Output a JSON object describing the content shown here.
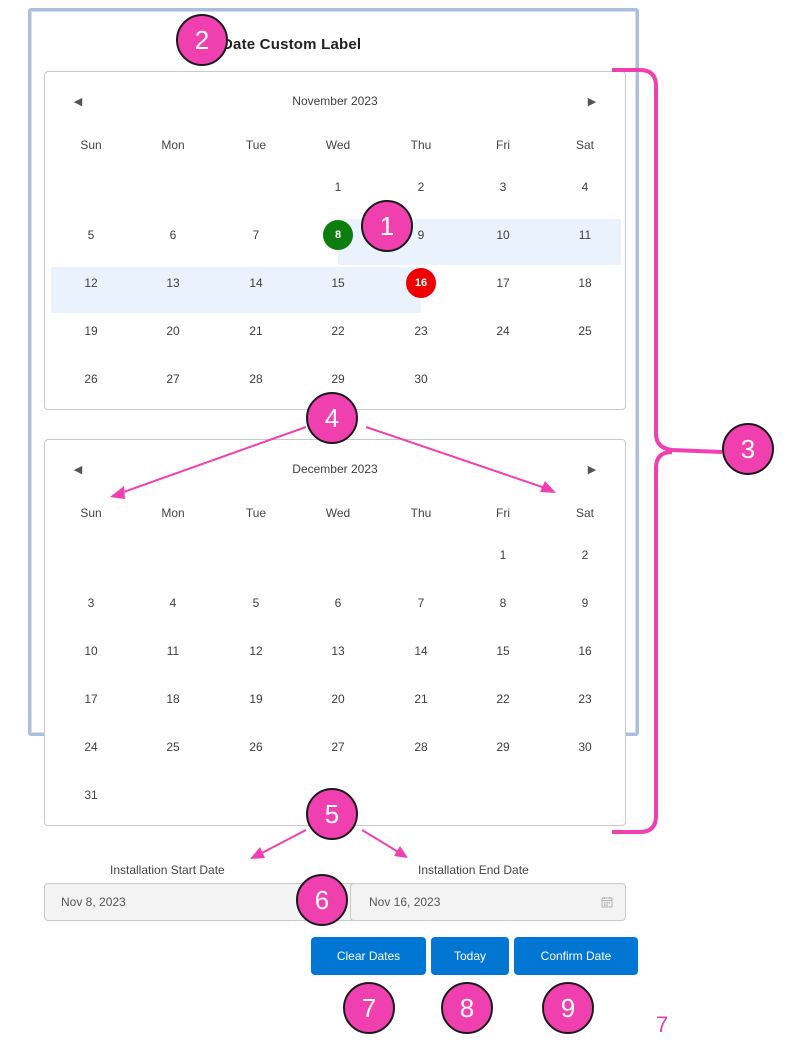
{
  "title": "Date Custom Label",
  "calendars": [
    {
      "month": "November 2023",
      "dow": [
        "Sun",
        "Mon",
        "Tue",
        "Wed",
        "Thu",
        "Fri",
        "Sat"
      ],
      "weeks": [
        [
          "",
          "",
          "",
          "1",
          "2",
          "3",
          "4"
        ],
        [
          "5",
          "6",
          "7",
          "8",
          "9",
          "10",
          "11"
        ],
        [
          "12",
          "13",
          "14",
          "15",
          "16",
          "17",
          "18"
        ],
        [
          "19",
          "20",
          "21",
          "22",
          "23",
          "24",
          "25"
        ],
        [
          "26",
          "27",
          "28",
          "29",
          "30",
          "",
          ""
        ]
      ],
      "start_day": "8",
      "end_day": "16"
    },
    {
      "month": "December 2023",
      "dow": [
        "Sun",
        "Mon",
        "Tue",
        "Wed",
        "Thu",
        "Fri",
        "Sat"
      ],
      "weeks": [
        [
          "",
          "",
          "",
          "",
          "",
          "1",
          "2"
        ],
        [
          "3",
          "4",
          "5",
          "6",
          "7",
          "8",
          "9"
        ],
        [
          "10",
          "11",
          "12",
          "13",
          "14",
          "15",
          "16"
        ],
        [
          "17",
          "18",
          "19",
          "20",
          "21",
          "22",
          "23"
        ],
        [
          "24",
          "25",
          "26",
          "27",
          "28",
          "29",
          "30"
        ],
        [
          "31",
          "",
          "",
          "",
          "",
          "",
          ""
        ]
      ]
    }
  ],
  "fields": {
    "start_label": "Installation Start Date",
    "start_value": "Nov 8, 2023",
    "end_label": "Installation End Date",
    "end_value": "Nov 16, 2023"
  },
  "buttons": {
    "clear": "Clear Dates",
    "today": "Today",
    "confirm": "Confirm Date"
  },
  "annotations": {
    "b1": "1",
    "b2": "2",
    "b3": "3",
    "b4": "4",
    "b5": "5",
    "b6": "6",
    "b7": "7",
    "b8": "8",
    "b9": "9",
    "side_number": "7"
  },
  "colors": {
    "start_circle": "#0d7d0d",
    "end_circle": "#ee0000",
    "range_band": "#eaf3fd",
    "button": "#0176d3",
    "annotation": "#f040b0"
  },
  "icons": {
    "prev": "left-triangle-icon",
    "next": "right-triangle-icon",
    "date_field": "calendar-icon"
  }
}
